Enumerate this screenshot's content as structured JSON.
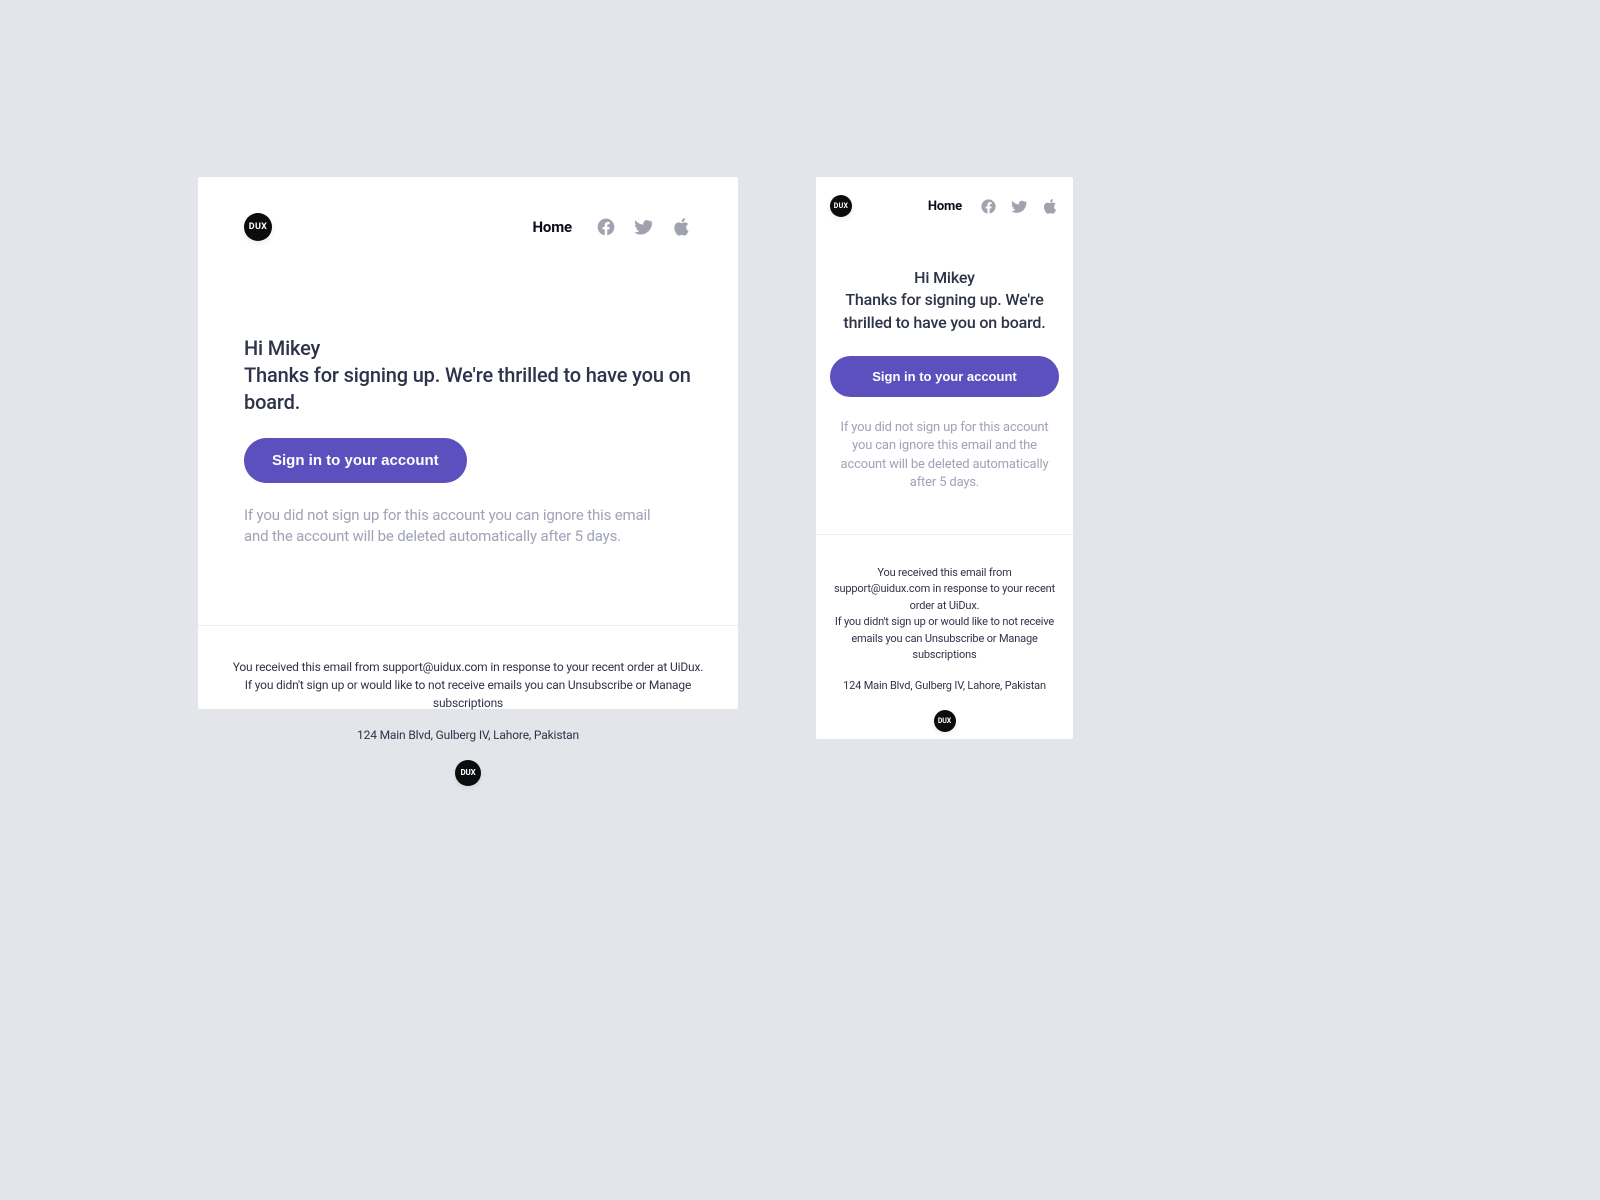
{
  "logo_text": "DUX",
  "nav": {
    "home_label": "Home"
  },
  "content": {
    "greeting": "Hi Mikey",
    "thanks_line": "Thanks for signing up. We're thrilled to have you on board.",
    "cta_label": "Sign in to your account",
    "not_signup_notice": "If you did not sign up for this account you can ignore this email and the account will be deleted automatically after 5 days."
  },
  "footer": {
    "received_line": "You received this email from support@uidux.com in response to your recent order at UiDux.",
    "unsubscribe_line": "If you didn't sign up or would like to not receive emails you can Unsubscribe or Manage subscriptions",
    "address": "124 Main Blvd, Gulberg IV, Lahore, Pakistan"
  },
  "colors": {
    "accent": "#5C50BF",
    "bg": "#E4E5EB",
    "text_primary": "#2F3349",
    "text_muted": "#9FA3B5"
  }
}
